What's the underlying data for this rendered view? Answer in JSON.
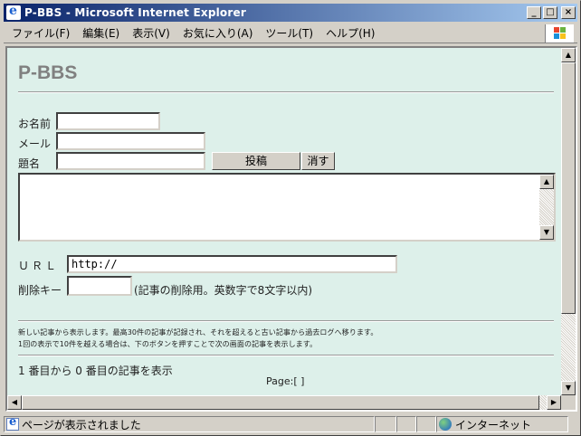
{
  "window": {
    "title": "P-BBS - Microsoft Internet Explorer",
    "minimize": "_",
    "maximize": "□",
    "close": "×"
  },
  "menu": {
    "items": [
      "ファイル(F)",
      "編集(E)",
      "表示(V)",
      "お気に入り(A)",
      "ツール(T)",
      "ヘルプ(H)"
    ]
  },
  "page": {
    "title": "P-BBS",
    "name_label": "お名前",
    "mail_label": "メール",
    "subject_label": "題名",
    "post_button": "投稿",
    "clear_button": "消す",
    "url_label": "ＵＲＬ",
    "url_value": "http://",
    "delkey_label": "削除キー",
    "delkey_hint": "(記事の削除用。英数字で8文字以内)",
    "notice_line1": "新しい記事から表示します。最高30件の記事が記録され、それを超えると古い記事から過去ログへ移ります。",
    "notice_line2": "1回の表示で10件を越える場合は、下のボタンを押すことで次の画面の記事を表示します。",
    "range_text": "1 番目から 0 番目の記事を表示",
    "pager": "Page:[ ]"
  },
  "status": {
    "message": "ページが表示されました",
    "zone": "インターネット"
  },
  "colors": {
    "page_bg": "#ddf0ea",
    "title_gray": "#808080",
    "titlebar_start": "#0a246a",
    "titlebar_end": "#a6caf0"
  }
}
